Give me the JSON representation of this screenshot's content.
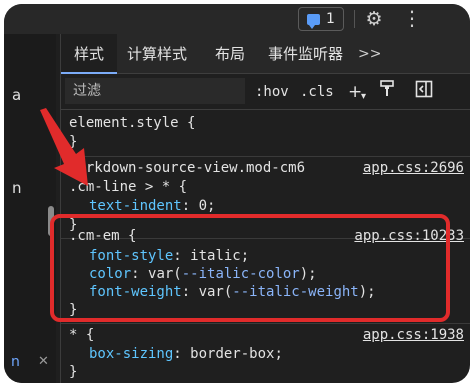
{
  "topbar": {
    "issues_count": "1",
    "icons": {
      "issues": "chat-bubble-icon",
      "settings": "gear-icon",
      "more": "kebab-icon"
    }
  },
  "left_panel": {
    "fragment_1": "a",
    "fragment_2": "n",
    "bottom_icon": "n",
    "bottom_close": "✕"
  },
  "tabs": [
    {
      "label": "样式",
      "active": true
    },
    {
      "label": "计算样式",
      "active": false
    },
    {
      "label": "布局",
      "active": false
    },
    {
      "label": "事件监听器",
      "active": false
    }
  ],
  "tabs_more": ">>",
  "filter": {
    "placeholder": "过滤",
    "hov_label": ":hov",
    "cls_label": ".cls",
    "new_rule_icon": "plus-icon",
    "plus_label": "+",
    "paint_icon": "paint-brush-icon",
    "sidebar_icon": "toggle-sidebar-icon"
  },
  "rules": {
    "element_style": {
      "selector": "element.style {",
      "close": "}"
    },
    "markdown": {
      "selector_1": "markdown-source-view.mod-cm6",
      "selector_2": ".cm-line > * {",
      "prop": "text-indent",
      "value": "0;",
      "close": "}",
      "source": "app.css:2696"
    },
    "cm_em": {
      "selector": ".cm-em {",
      "decls": [
        {
          "prop": "font-style",
          "value": "italic;"
        },
        {
          "prop": "color",
          "value": "var(",
          "var": "--italic-color",
          "tail": ");"
        },
        {
          "prop": "font-weight",
          "value": "var(",
          "var": "--italic-weight",
          "tail": ");"
        }
      ],
      "close": "}",
      "source": "app.css:10233"
    },
    "universal": {
      "selector": "* {",
      "prop": "box-sizing",
      "value": "border-box;",
      "close": "}",
      "source": "app.css:1938"
    }
  },
  "colors": {
    "annotation": "#e12b2b",
    "property": "#5fc6ff",
    "variable": "#8ab4f8",
    "tab_indicator": "#7cacf8"
  }
}
